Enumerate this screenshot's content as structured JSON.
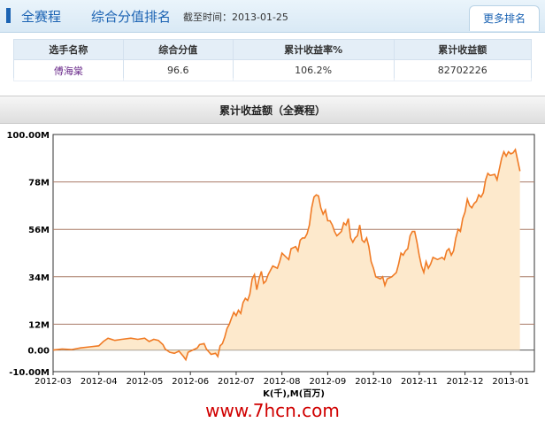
{
  "header": {
    "title_highlight": "全赛程",
    "title_rest": "综合分值排名",
    "date_text": "截至时间：2013-01-25",
    "more_label": "更多排名"
  },
  "table": {
    "columns": [
      "选手名称",
      "综合分值",
      "累计收益率%",
      "累计收益额"
    ],
    "rows": [
      [
        "傅海棠",
        "96.6",
        "106.2%",
        "82702226"
      ]
    ]
  },
  "chart_header": "累计收益额（全赛程）",
  "watermark": "www.7hcn.com",
  "chart_data": {
    "type": "area",
    "title": "累计收益额（全赛程）",
    "xlabel": "K(千),M(百万)",
    "ylabel": "",
    "x_ticks": [
      "2012-03",
      "2012-04",
      "2012-05",
      "2012-06",
      "2012-07",
      "2012-08",
      "2012-09",
      "2012-10",
      "2012-11",
      "2012-12",
      "2013-01"
    ],
    "y_ticks": [
      "-10.00M",
      "0.00",
      "12M",
      "34M",
      "56M",
      "78M",
      "100.00M"
    ],
    "ylim": [
      -10,
      100
    ],
    "y_unit": "M",
    "grid": true,
    "line_color": "#f07b25",
    "fill_color": "#fde9cc",
    "series": [
      {
        "values": [
          [
            0.0,
            0.0
          ],
          [
            0.2,
            0.5
          ],
          [
            0.4,
            0.2
          ],
          [
            0.6,
            1.0
          ],
          [
            0.8,
            1.5
          ],
          [
            1.0,
            2.0
          ],
          [
            1.1,
            4.0
          ],
          [
            1.2,
            5.5
          ],
          [
            1.35,
            4.5
          ],
          [
            1.5,
            5.0
          ],
          [
            1.7,
            5.5
          ],
          [
            1.85,
            5.0
          ],
          [
            2.0,
            5.5
          ],
          [
            2.1,
            4.0
          ],
          [
            2.2,
            5.0
          ],
          [
            2.3,
            4.5
          ],
          [
            2.4,
            2.5
          ],
          [
            2.45,
            0.5
          ],
          [
            2.55,
            -1.0
          ],
          [
            2.65,
            -1.5
          ],
          [
            2.75,
            -0.5
          ],
          [
            2.85,
            -3.0
          ],
          [
            2.9,
            -4.5
          ],
          [
            2.95,
            -1.0
          ],
          [
            3.05,
            0.0
          ],
          [
            3.15,
            1.0
          ],
          [
            3.2,
            2.5
          ],
          [
            3.3,
            3.0
          ],
          [
            3.35,
            0.5
          ],
          [
            3.45,
            -2.0
          ],
          [
            3.55,
            -1.5
          ],
          [
            3.6,
            -3.0
          ],
          [
            3.65,
            2.0
          ],
          [
            3.7,
            3.0
          ],
          [
            3.75,
            6.0
          ],
          [
            3.8,
            10.0
          ],
          [
            3.85,
            12.0
          ],
          [
            3.9,
            15.0
          ],
          [
            3.95,
            17.5
          ],
          [
            4.0,
            16.0
          ],
          [
            4.05,
            18.5
          ],
          [
            4.1,
            17.0
          ],
          [
            4.15,
            22.0
          ],
          [
            4.2,
            24.0
          ],
          [
            4.25,
            23.0
          ],
          [
            4.3,
            26.0
          ],
          [
            4.35,
            33.0
          ],
          [
            4.4,
            35.0
          ],
          [
            4.45,
            28.0
          ],
          [
            4.5,
            33.0
          ],
          [
            4.55,
            36.5
          ],
          [
            4.6,
            31.0
          ],
          [
            4.65,
            32.0
          ],
          [
            4.7,
            35.0
          ],
          [
            4.8,
            39.0
          ],
          [
            4.9,
            38.0
          ],
          [
            4.95,
            41.0
          ],
          [
            5.0,
            45.0
          ],
          [
            5.05,
            44.0
          ],
          [
            5.1,
            43.0
          ],
          [
            5.15,
            42.0
          ],
          [
            5.2,
            47.0
          ],
          [
            5.3,
            48.0
          ],
          [
            5.35,
            46.0
          ],
          [
            5.4,
            51.0
          ],
          [
            5.45,
            52.0
          ],
          [
            5.5,
            52.0
          ],
          [
            5.55,
            54.0
          ],
          [
            5.6,
            58.0
          ],
          [
            5.65,
            66.0
          ],
          [
            5.7,
            71.0
          ],
          [
            5.75,
            72.0
          ],
          [
            5.8,
            71.5
          ],
          [
            5.85,
            66.0
          ],
          [
            5.9,
            63.0
          ],
          [
            5.95,
            65.0
          ],
          [
            6.0,
            60.0
          ],
          [
            6.05,
            60.0
          ],
          [
            6.1,
            58.0
          ],
          [
            6.15,
            55.0
          ],
          [
            6.2,
            53.0
          ],
          [
            6.3,
            55.0
          ],
          [
            6.35,
            59.0
          ],
          [
            6.4,
            58.0
          ],
          [
            6.45,
            61.0
          ],
          [
            6.5,
            52.0
          ],
          [
            6.55,
            50.0
          ],
          [
            6.6,
            52.0
          ],
          [
            6.65,
            53.0
          ],
          [
            6.7,
            58.0
          ],
          [
            6.75,
            51.0
          ],
          [
            6.8,
            50.0
          ],
          [
            6.85,
            52.0
          ],
          [
            6.9,
            48.0
          ],
          [
            6.95,
            41.0
          ],
          [
            7.0,
            38.0
          ],
          [
            7.05,
            34.0
          ],
          [
            7.15,
            33.0
          ],
          [
            7.2,
            34.0
          ],
          [
            7.25,
            30.0
          ],
          [
            7.3,
            33.0
          ],
          [
            7.4,
            34.0
          ],
          [
            7.5,
            36.0
          ],
          [
            7.55,
            40.0
          ],
          [
            7.6,
            45.0
          ],
          [
            7.65,
            44.0
          ],
          [
            7.7,
            46.0
          ],
          [
            7.75,
            47.0
          ],
          [
            7.8,
            53.0
          ],
          [
            7.85,
            55.0
          ],
          [
            7.9,
            55.0
          ],
          [
            7.95,
            50.0
          ],
          [
            8.0,
            44.0
          ],
          [
            8.05,
            39.0
          ],
          [
            8.1,
            36.0
          ],
          [
            8.15,
            41.0
          ],
          [
            8.2,
            38.0
          ],
          [
            8.25,
            40.0
          ],
          [
            8.3,
            43.0
          ],
          [
            8.4,
            42.0
          ],
          [
            8.5,
            43.0
          ],
          [
            8.55,
            42.0
          ],
          [
            8.6,
            46.0
          ],
          [
            8.65,
            47.0
          ],
          [
            8.7,
            44.0
          ],
          [
            8.75,
            46.0
          ],
          [
            8.8,
            52.0
          ],
          [
            8.85,
            56.0
          ],
          [
            8.9,
            55.0
          ],
          [
            8.95,
            61.0
          ],
          [
            9.0,
            64.0
          ],
          [
            9.05,
            70.0
          ],
          [
            9.1,
            67.0
          ],
          [
            9.15,
            66.0
          ],
          [
            9.2,
            68.0
          ],
          [
            9.25,
            69.0
          ],
          [
            9.3,
            72.0
          ],
          [
            9.35,
            71.0
          ],
          [
            9.4,
            73.0
          ],
          [
            9.45,
            79.0
          ],
          [
            9.5,
            82.0
          ],
          [
            9.55,
            81.0
          ],
          [
            9.65,
            81.5
          ],
          [
            9.7,
            79.0
          ],
          [
            9.75,
            84.0
          ],
          [
            9.8,
            89.0
          ],
          [
            9.85,
            92.0
          ],
          [
            9.9,
            90.0
          ],
          [
            9.95,
            92.0
          ],
          [
            10.0,
            91.0
          ],
          [
            10.05,
            91.5
          ],
          [
            10.1,
            93.0
          ],
          [
            10.15,
            88.0
          ],
          [
            10.2,
            83.0
          ]
        ]
      }
    ]
  }
}
